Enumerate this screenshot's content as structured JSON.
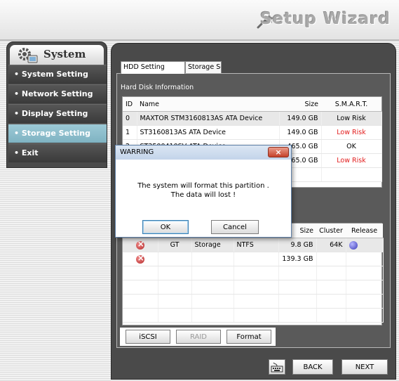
{
  "header": {
    "title": "Setup Wizard"
  },
  "sidebar": {
    "title": "System",
    "items": [
      {
        "label": "• System Setting"
      },
      {
        "label": "• Network Setting"
      },
      {
        "label": "• Display Setting"
      },
      {
        "label": "• Storage Setting"
      },
      {
        "label": "• Exit"
      }
    ]
  },
  "tabs": [
    {
      "label": "HDD Setting"
    },
    {
      "label": "Storage Setting"
    }
  ],
  "hdd": {
    "section_label": "Hard Disk Information",
    "columns": [
      "ID",
      "Name",
      "Size",
      "S.M.A.R.T."
    ],
    "rows": [
      {
        "id": "0",
        "name": "MAXTOR STM3160813AS ATA Device",
        "size": "149.0 GB",
        "smart": "Low Risk"
      },
      {
        "id": "1",
        "name": "ST3160813AS ATA Device",
        "size": "149.0 GB",
        "smart": "Low Risk"
      },
      {
        "id": "2",
        "name": "ST3500410SV ATA Device",
        "size": "465.0 GB",
        "smart": "OK"
      },
      {
        "id": "",
        "name": "",
        "size": "465.0 GB",
        "smart": "Low Risk"
      }
    ]
  },
  "partition": {
    "columns": [
      "Size",
      "Cluster",
      "Release"
    ],
    "rows": [
      {
        "type": "GT",
        "label": "Storage",
        "fs": "NTFS",
        "size": "9.8 GB",
        "cluster": "64K"
      },
      {
        "type": "",
        "label": "",
        "fs": "",
        "size": "139.3 GB",
        "cluster": ""
      }
    ]
  },
  "buttons": {
    "iscsi": "iSCSI",
    "raid": "RAID",
    "format": "Format",
    "back": "BACK",
    "next": "NEXT"
  },
  "dialog": {
    "title": "WARRING",
    "close": "×",
    "message_line1": "The system will format this partition .",
    "message_line2": "The data will lost !",
    "ok": "OK",
    "cancel": "Cancel"
  },
  "colors": {
    "risk": "#e21c1c",
    "active_nav": "#8cbdcb"
  }
}
